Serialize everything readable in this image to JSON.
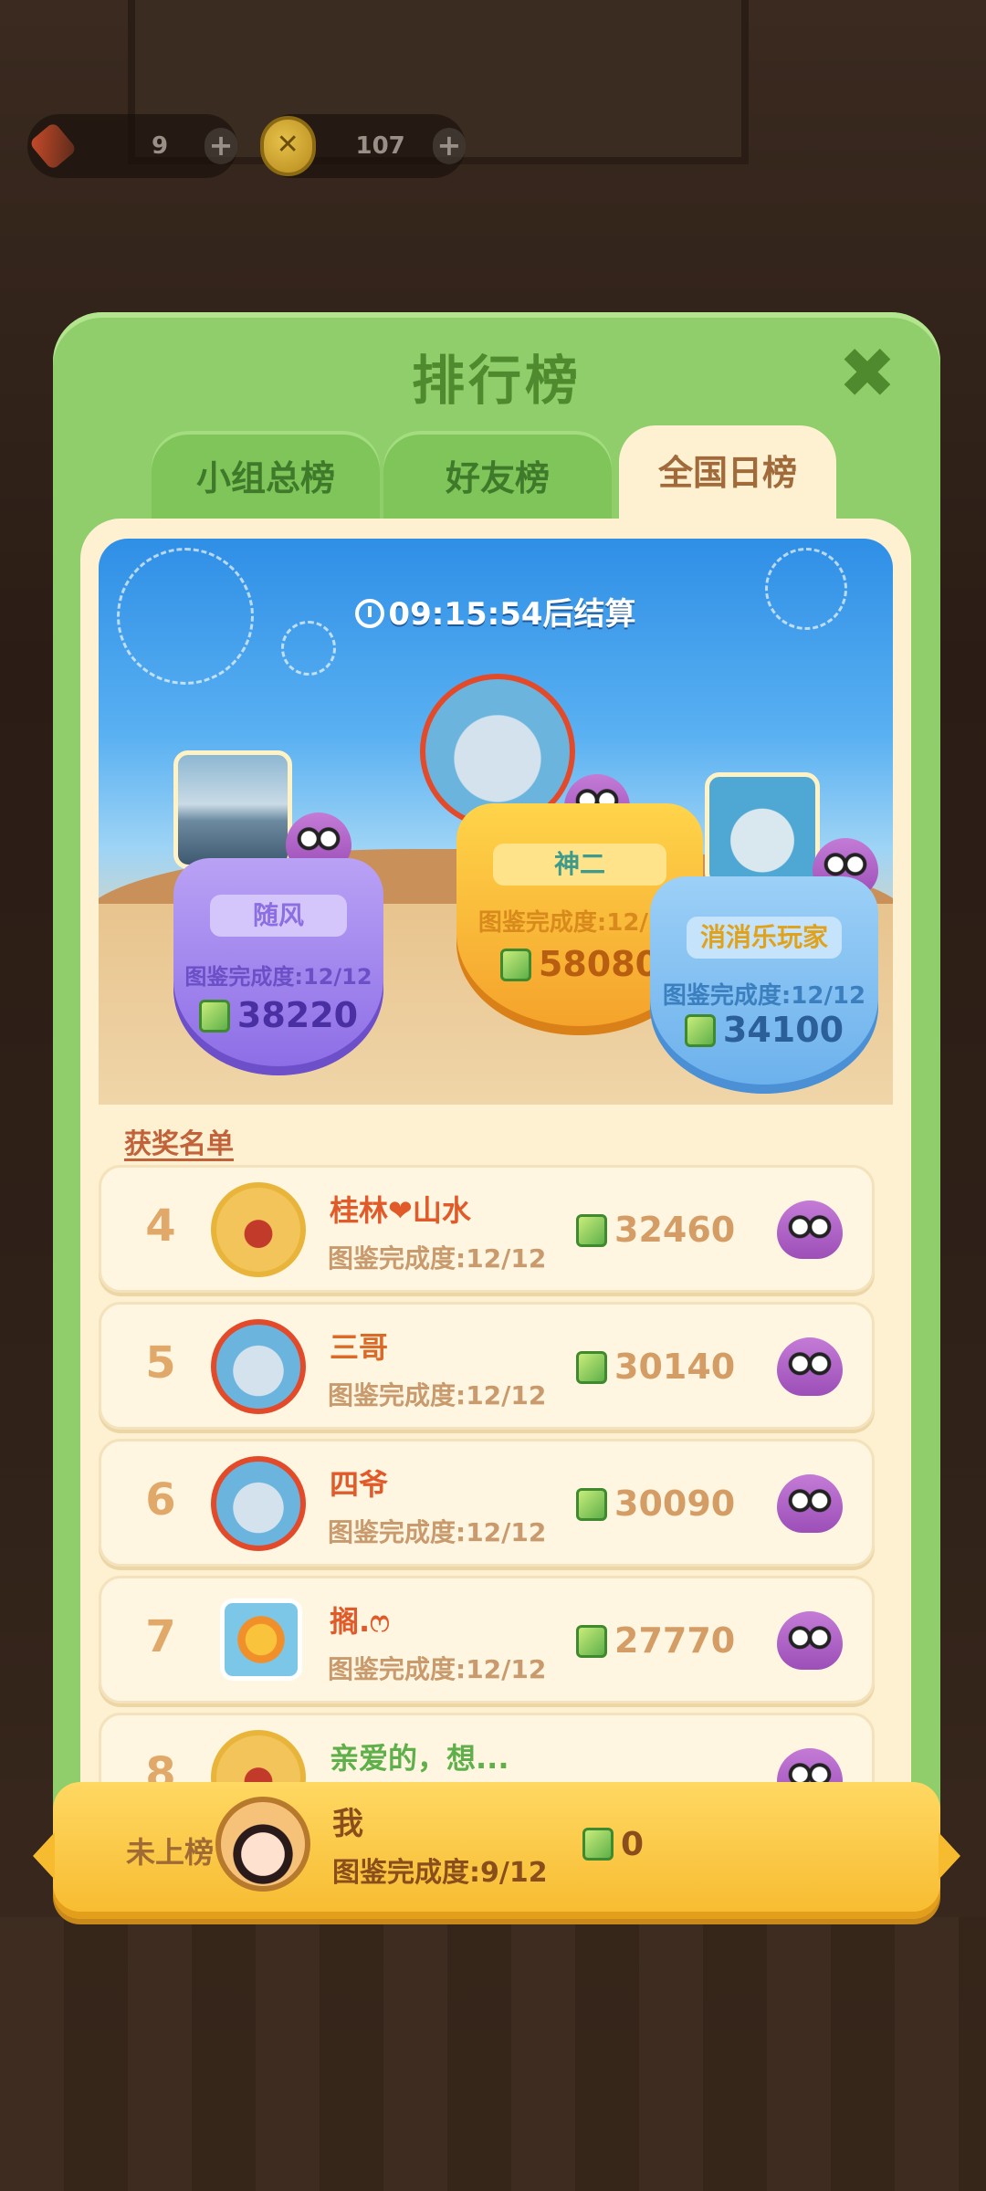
{
  "hud": {
    "ammo": "9",
    "coins": "107",
    "plus": "+"
  },
  "panel": {
    "title": "排行榜",
    "close": "✖"
  },
  "tabs": [
    {
      "label": "小组总榜",
      "active": false
    },
    {
      "label": "好友榜",
      "active": false
    },
    {
      "label": "全国日榜",
      "active": true
    }
  ],
  "timer": "09:15:54后结算",
  "podium": [
    {
      "rank": 2,
      "name": "随风",
      "progress": "图鉴完成度:12/12",
      "score": "38220"
    },
    {
      "rank": 1,
      "name": "神二",
      "progress": "图鉴完成度:12/12",
      "score": "58080"
    },
    {
      "rank": 3,
      "name": "消消乐玩家",
      "progress": "图鉴完成度:12/12",
      "score": "34100"
    }
  ],
  "winners_title": "获奖名单",
  "rows": [
    {
      "rank": "4",
      "name": "桂林❤山水",
      "progress": "图鉴完成度:12/12",
      "score": "32460"
    },
    {
      "rank": "5",
      "name": "三哥",
      "progress": "图鉴完成度:12/12",
      "score": "30140"
    },
    {
      "rank": "6",
      "name": "四爷",
      "progress": "图鉴完成度:12/12",
      "score": "30090"
    },
    {
      "rank": "7",
      "name": "搁.ෆ",
      "progress": "图鉴完成度:12/12",
      "score": "27770"
    },
    {
      "rank": "8",
      "name": "亲爱的，想...",
      "progress": "",
      "score": ""
    }
  ],
  "me": {
    "status": "未上榜",
    "name": "我",
    "progress": "图鉴完成度:9/12",
    "score": "0"
  }
}
